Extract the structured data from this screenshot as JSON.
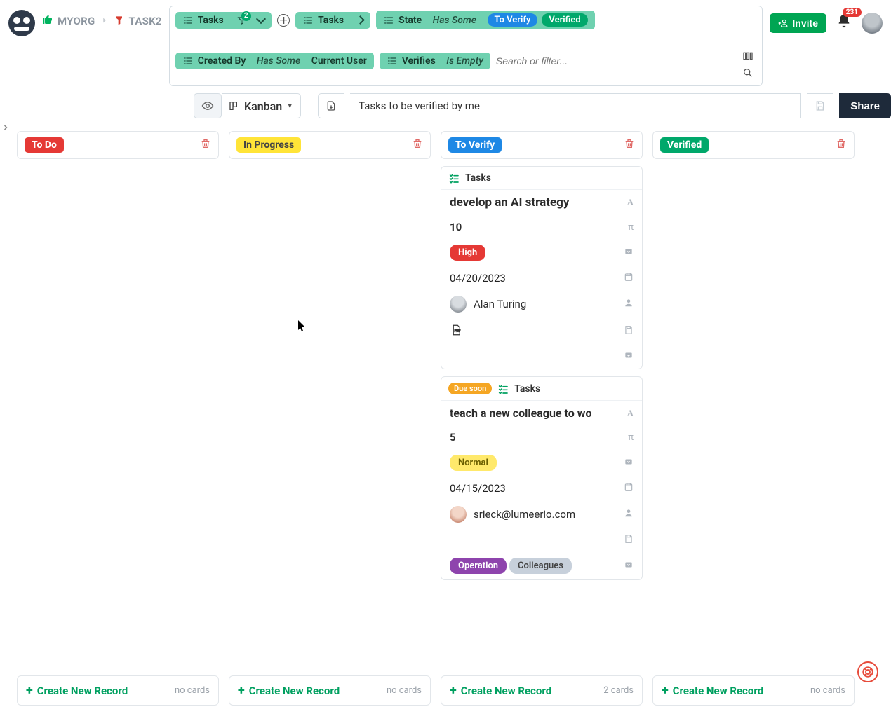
{
  "breadcrumb": {
    "org": "MYORG",
    "project": "TASK2"
  },
  "filters": {
    "source_chip": "Tasks",
    "funnel_count": "2",
    "link_chip": "Tasks",
    "state": {
      "label": "State",
      "mode": "Has Some",
      "values": [
        "To Verify",
        "Verified"
      ]
    },
    "created_by": {
      "label": "Created By",
      "mode": "Has Some",
      "value": "Current User"
    },
    "verifies": {
      "label": "Verifies",
      "mode": "Is Empty"
    },
    "search_placeholder": "Search or filter..."
  },
  "header_actions": {
    "invite": "Invite",
    "notifications": "231"
  },
  "toolbar": {
    "view_type": "Kanban",
    "view_name": "Tasks to be verified by me",
    "share": "Share"
  },
  "columns": [
    {
      "id": "todo",
      "label": "To Do",
      "color": "pill-red",
      "count_text": "no cards"
    },
    {
      "id": "inprogress",
      "label": "In Progress",
      "color": "pill-yellow",
      "count_text": "no cards"
    },
    {
      "id": "toverify",
      "label": "To Verify",
      "color": "pill-blue",
      "count_text": "2 cards"
    },
    {
      "id": "verified",
      "label": "Verified",
      "color": "pill-green",
      "count_text": "no cards"
    }
  ],
  "create_label": "Create New Record",
  "cards": {
    "toverify": [
      {
        "collection": "Tasks",
        "title": "develop an AI strategy",
        "effort": "10",
        "priority": {
          "label": "High",
          "color": "pill-red"
        },
        "date": "04/20/2023",
        "assignee": "Alan Turing",
        "has_file": true,
        "tags": []
      },
      {
        "due_badge": "Due soon",
        "collection": "Tasks",
        "title": "teach a new colleague to wo",
        "effort": "5",
        "priority": {
          "label": "Normal",
          "color": "pill-lyellow"
        },
        "date": "04/15/2023",
        "assignee": "srieck@lumeerio.com",
        "has_file": false,
        "tags": [
          {
            "label": "Operation",
            "color": "pill-purple"
          },
          {
            "label": "Colleagues",
            "color": "pill-gray"
          }
        ]
      }
    ]
  }
}
